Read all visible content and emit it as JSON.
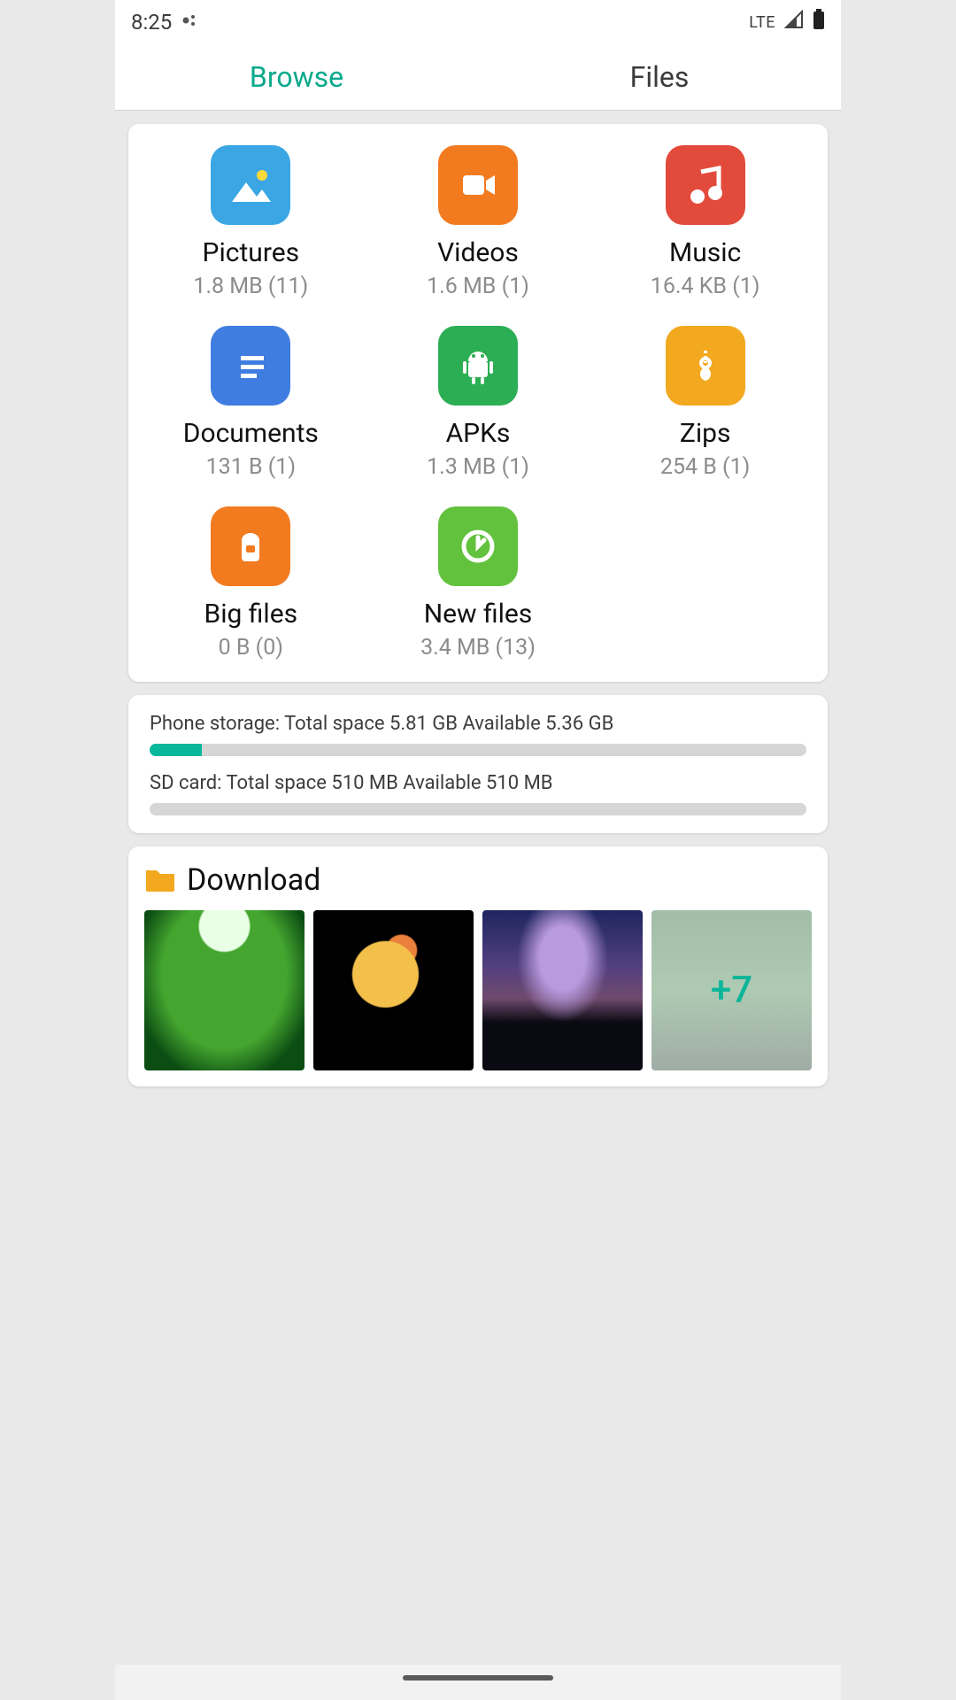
{
  "statusbar": {
    "time": "8:25",
    "network": "LTE"
  },
  "tabs": {
    "browse": "Browse",
    "files": "Files"
  },
  "categories": [
    {
      "key": "pictures",
      "name": "Pictures",
      "info": "1.8 MB (11)",
      "color": "#3aa6e4",
      "icon": "pictures-icon"
    },
    {
      "key": "videos",
      "name": "Videos",
      "info": "1.6 MB (1)",
      "color": "#f27a1f",
      "icon": "videos-icon"
    },
    {
      "key": "music",
      "name": "Music",
      "info": "16.4 KB (1)",
      "color": "#e24a3b",
      "icon": "music-icon"
    },
    {
      "key": "documents",
      "name": "Documents",
      "info": "131 B (1)",
      "color": "#3f7de0",
      "icon": "documents-icon"
    },
    {
      "key": "apks",
      "name": "APKs",
      "info": "1.3 MB (1)",
      "color": "#2cae54",
      "icon": "apks-icon"
    },
    {
      "key": "zips",
      "name": "Zips",
      "info": "254 B (1)",
      "color": "#f2a81f",
      "icon": "zips-icon"
    },
    {
      "key": "bigfiles",
      "name": "Big files",
      "info": "0 B (0)",
      "color": "#f27a1f",
      "icon": "bigfiles-icon"
    },
    {
      "key": "newfiles",
      "name": "New files",
      "info": "3.4 MB (13)",
      "color": "#62c23d",
      "icon": "newfiles-icon"
    }
  ],
  "storage": {
    "phone": {
      "text": "Phone storage: Total space 5.81 GB  Available 5.36 GB",
      "used_percent": 8
    },
    "sd": {
      "text": "SD card: Total space 510 MB  Available 510 MB",
      "used_percent": 0
    }
  },
  "download": {
    "title": "Download",
    "more_label": "+7",
    "thumbs": [
      {
        "name": "thumb-garden",
        "class": "th-garden"
      },
      {
        "name": "thumb-bird",
        "class": "th-bird"
      },
      {
        "name": "thumb-night",
        "class": "th-night"
      },
      {
        "name": "thumb-more",
        "class": "th-forest",
        "is_more": true
      }
    ]
  }
}
